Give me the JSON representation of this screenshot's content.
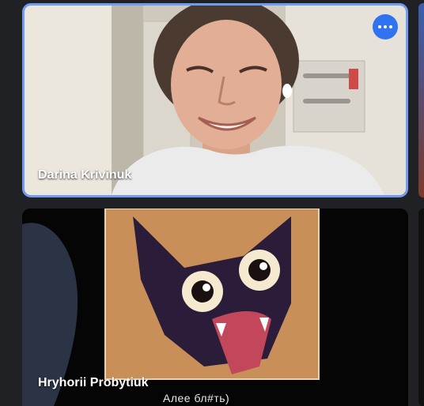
{
  "participants": [
    {
      "name": "Darina Krivinuk",
      "highlighted": true
    },
    {
      "name": "Hryhorii Probytiuk",
      "caption": "Алее бл#ть)"
    }
  ],
  "colors": {
    "background": "#202124",
    "active_border": "#6f9bf0",
    "more_button": "#2f73f0"
  },
  "icons": {
    "more_options": "more-horizontal-icon"
  }
}
